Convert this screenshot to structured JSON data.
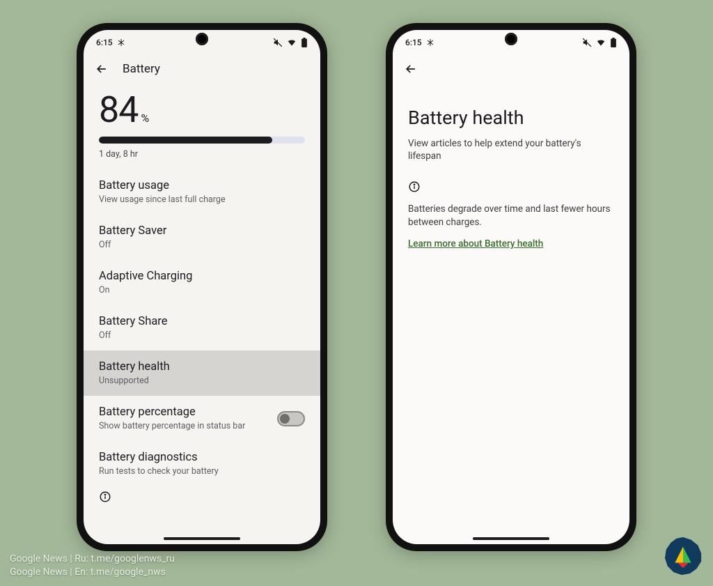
{
  "status": {
    "time": "6:15"
  },
  "left": {
    "appbar_title": "Battery",
    "percent_value": "84",
    "percent_symbol": "%",
    "progress_percent": 84,
    "estimate": "1 day, 8 hr",
    "items": [
      {
        "title": "Battery usage",
        "sub": "View usage since last full charge"
      },
      {
        "title": "Battery Saver",
        "sub": "Off"
      },
      {
        "title": "Adaptive Charging",
        "sub": "On"
      },
      {
        "title": "Battery Share",
        "sub": "Off"
      },
      {
        "title": "Battery health",
        "sub": "Unsupported",
        "highlight": true
      },
      {
        "title": "Battery percentage",
        "sub": "Show battery percentage in status bar",
        "toggle": true,
        "toggle_on": false
      },
      {
        "title": "Battery diagnostics",
        "sub": "Run tests to check your battery"
      }
    ]
  },
  "right": {
    "title": "Battery health",
    "subtitle": "View articles to help extend your battery's lifespan",
    "info_text": "Batteries degrade over time and last fewer hours between charges.",
    "link_text": "Learn more about Battery health"
  },
  "watermark": {
    "line1": "Google News | Ru: t.me/googlenws_ru",
    "line2": "Google News | En: t.me/google_nws"
  }
}
